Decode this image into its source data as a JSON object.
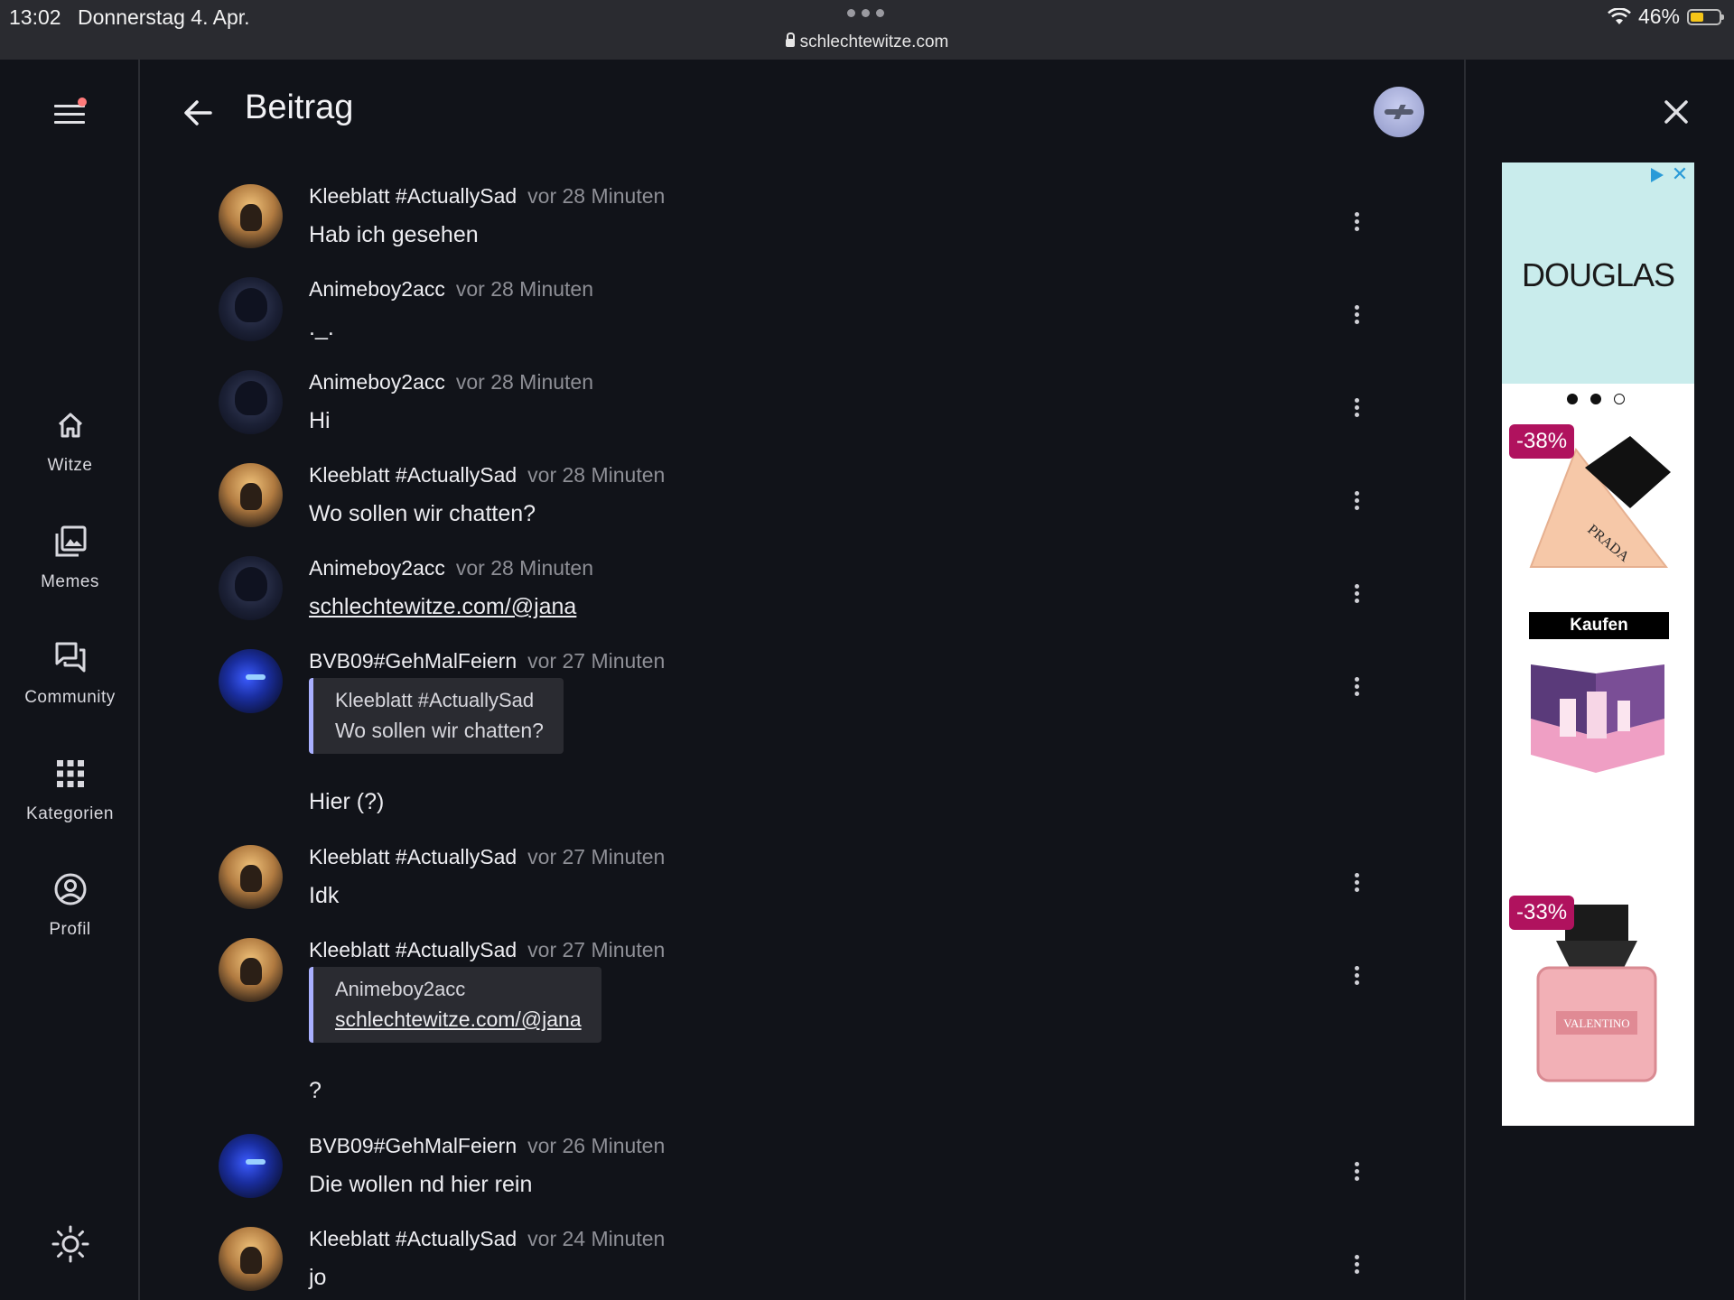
{
  "statusbar": {
    "time": "13:02",
    "date": "Donnerstag 4. Apr.",
    "url": "schlechtewitze.com",
    "battery": "46%",
    "battery_level": 0.46
  },
  "nav": {
    "items": [
      {
        "label": "Witze",
        "icon": "home-icon"
      },
      {
        "label": "Memes",
        "icon": "images-icon"
      },
      {
        "label": "Community",
        "icon": "forum-icon"
      },
      {
        "label": "Kategorien",
        "icon": "apps-grid-icon"
      },
      {
        "label": "Profil",
        "icon": "account-circle-icon"
      }
    ]
  },
  "header": {
    "title": "Beitrag"
  },
  "comments": [
    {
      "name": "Kleeblatt #ActuallySad",
      "time": "vor 28 Minuten",
      "text": "Hab ich gesehen"
    },
    {
      "name": "Animeboy2acc",
      "time": "vor 28 Minuten",
      "text": "._."
    },
    {
      "name": "Animeboy2acc",
      "time": "vor 28 Minuten",
      "text": "Hi"
    },
    {
      "name": "Kleeblatt #ActuallySad",
      "time": "vor 28 Minuten",
      "text": "Wo sollen wir chatten?"
    },
    {
      "name": "Animeboy2acc",
      "time": "vor 28 Minuten",
      "text": "schlechtewitze.com/@jana"
    },
    {
      "name": "BVB09#GehMalFeiern",
      "time": "vor 27 Minuten",
      "quote_name": "Kleeblatt #ActuallySad",
      "quote_text": "Wo sollen wir chatten?",
      "text": "Hier (?)"
    },
    {
      "name": "Kleeblatt #ActuallySad",
      "time": "vor 27 Minuten",
      "text": "Idk"
    },
    {
      "name": "Kleeblatt #ActuallySad",
      "time": "vor 27 Minuten",
      "quote_name": "Animeboy2acc",
      "quote_text": "schlechtewitze.com/@jana",
      "text": "?"
    },
    {
      "name": "BVB09#GehMalFeiern",
      "time": "vor 26 Minuten",
      "text": "Die wollen nd hier rein"
    },
    {
      "name": "Kleeblatt #ActuallySad",
      "time": "vor 24 Minuten",
      "text": "jo"
    }
  ],
  "ad": {
    "brand": "DOUGLAS",
    "badge1": "-38%",
    "buy": "Kaufen",
    "badge2": "-33%",
    "bottle1_label": "PRADA",
    "bottle2_label": "VALENTINO"
  },
  "colors": {
    "background": "#111319",
    "accent_quote": "#a9b0ff",
    "badge": "#b0125e",
    "ad_top": "#c9ecec"
  }
}
